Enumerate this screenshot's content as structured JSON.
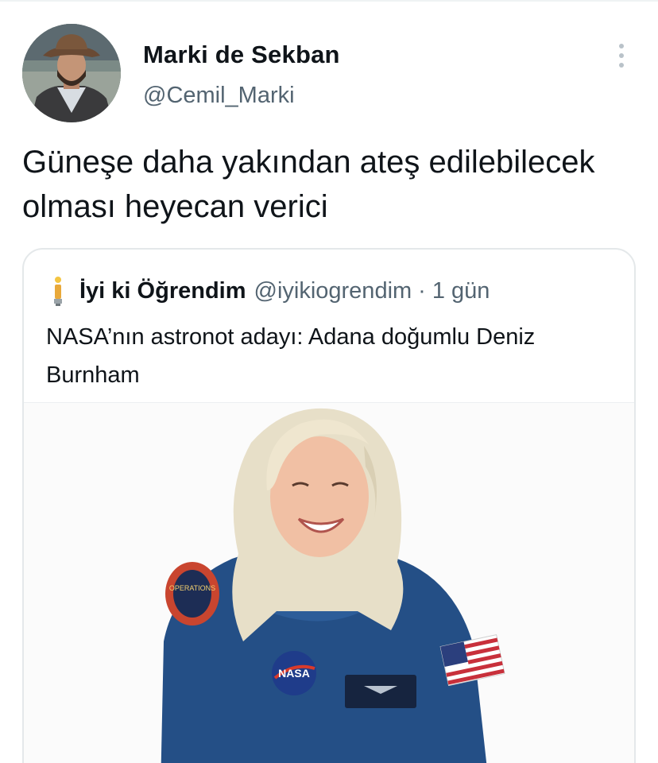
{
  "tweet": {
    "display_name": "Marki de Sekban",
    "handle": "@Cemil_Marki",
    "text": "Güneşe daha yakından ateş edilebilecek olması heyecan verici",
    "avatar_icon": "avatar-photo",
    "more_icon": "more-options-icon"
  },
  "quoted": {
    "icon": "lightbulb-icon",
    "display_name": "İyi ki Öğrendim",
    "handle": "@iyikiogrendim",
    "separator": "·",
    "time": "1 gün",
    "text": "NASA’nın astronot adayı: Adana doğumlu Deniz Burnham",
    "media_badges": {
      "nasa_patch": "NASA",
      "mission_patch": "OPERATIONS"
    }
  },
  "colors": {
    "primary_text": "#0f1419",
    "secondary_text": "#536471",
    "border": "#e4e8ea",
    "flight_suit": "#244f86"
  }
}
